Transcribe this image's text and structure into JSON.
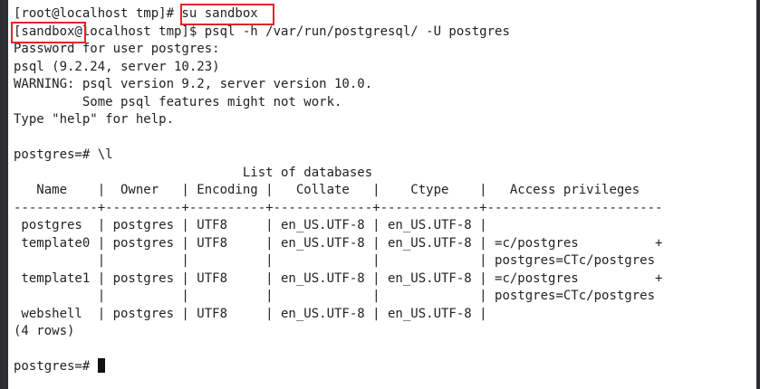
{
  "terminal": {
    "lines": [
      "[root@localhost tmp]# su sandbox",
      "[sandbox@localhost tmp]$ psql -h /var/run/postgresql/ -U postgres",
      "Password for user postgres:",
      "psql (9.2.24, server 10.23)",
      "WARNING: psql version 9.2, server version 10.0.",
      "         Some psql features might not work.",
      "Type \"help\" for help.",
      "",
      "postgres=# \\l",
      "                              List of databases",
      "   Name    |  Owner   | Encoding |   Collate   |    Ctype    |   Access privileges",
      "-----------+----------+----------+-------------+-------------+-----------------------",
      " postgres  | postgres | UTF8     | en_US.UTF-8 | en_US.UTF-8 |",
      " template0 | postgres | UTF8     | en_US.UTF-8 | en_US.UTF-8 | =c/postgres          +",
      "           |          |          |             |             | postgres=CTc/postgres",
      " template1 | postgres | UTF8     | en_US.UTF-8 | en_US.UTF-8 | =c/postgres          +",
      "           |          |          |             |             | postgres=CTc/postgres",
      " webshell  | postgres | UTF8     | en_US.UTF-8 | en_US.UTF-8 |",
      "(4 rows)",
      "",
      "postgres=# "
    ],
    "highlight_color": "#e32424",
    "cursor_icon": "block-cursor-icon"
  }
}
